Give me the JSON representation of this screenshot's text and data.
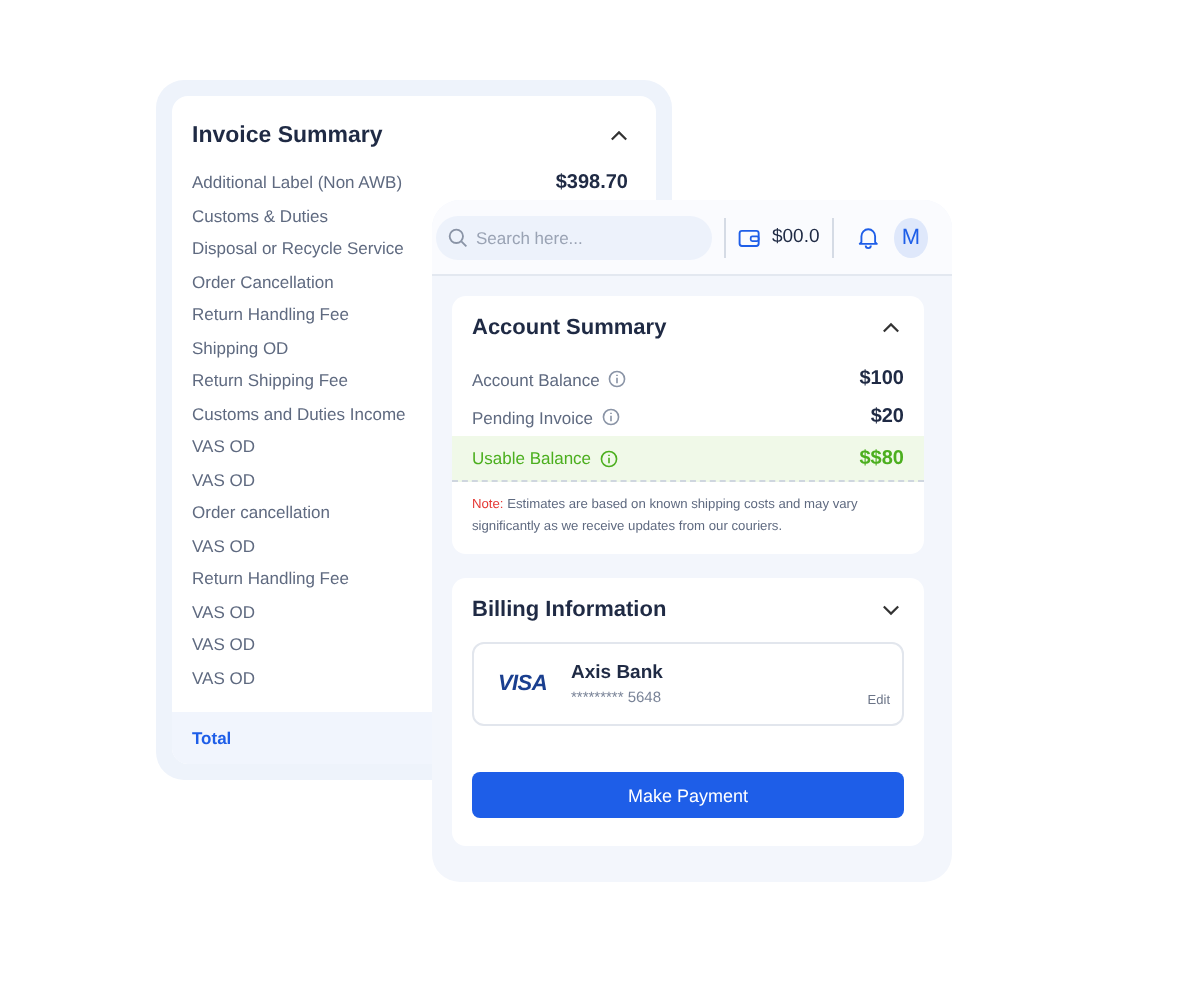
{
  "invoice_summary": {
    "title": "Invoice Summary",
    "expanded": true,
    "items": [
      {
        "label": "Additional Label (Non AWB)",
        "amount": "$398.70"
      },
      {
        "label": "Customs & Duties"
      },
      {
        "label": "Disposal or Recycle Service"
      },
      {
        "label": "Order Cancellation"
      },
      {
        "label": "Return Handling Fee"
      },
      {
        "label": "Shipping OD"
      },
      {
        "label": "Return Shipping Fee"
      },
      {
        "label": "Customs and Duties Income"
      },
      {
        "label": "VAS OD"
      },
      {
        "label": "VAS OD"
      },
      {
        "label": "Order cancellation"
      },
      {
        "label": "VAS OD"
      },
      {
        "label": "Return Handling Fee"
      },
      {
        "label": "VAS OD"
      },
      {
        "label": "VAS OD"
      },
      {
        "label": "VAS OD"
      }
    ],
    "total_label": "Total"
  },
  "header": {
    "search_placeholder": "Search here...",
    "wallet_amount": "$00.0",
    "avatar_initial": "M"
  },
  "account_summary": {
    "title": "Account Summary",
    "expanded": true,
    "rows": [
      {
        "label": "Account Balance",
        "value": "$100",
        "kind": "normal"
      },
      {
        "label": "Pending Invoice",
        "value": "$20",
        "kind": "normal"
      },
      {
        "label": "Usable Balance",
        "value": "$$80",
        "kind": "highlight"
      }
    ],
    "note_label": "Note:",
    "note_text": "Estimates are based on known shipping costs and may vary significantly as we receive updates from our couriers."
  },
  "billing": {
    "title": "Billing Information",
    "expanded": false,
    "card": {
      "brand": "VISA",
      "bank": "Axis Bank",
      "number": "********* 5648",
      "edit": "Edit"
    },
    "pay_button": "Make Payment"
  }
}
